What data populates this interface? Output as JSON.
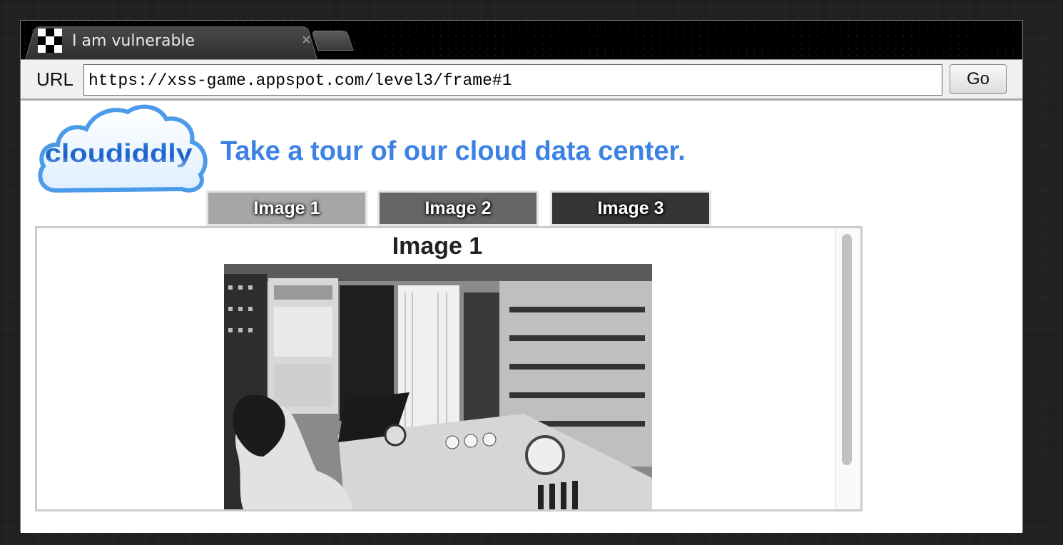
{
  "browser": {
    "tab_title": "I am vulnerable",
    "tab_close": "×",
    "url_label": "URL",
    "url_value": "https://xss-game.appspot.com/level3/frame#1",
    "go_label": "Go"
  },
  "page": {
    "logo_text": "cloudiddly",
    "headline": "Take a tour of our cloud data center.",
    "tabs": [
      {
        "label": "Image 1",
        "color": "#a6a6a6"
      },
      {
        "label": "Image 2",
        "color": "#666666"
      },
      {
        "label": "Image 3",
        "color": "#353535"
      }
    ],
    "content_title": "Image 1",
    "accent_color": "#3b82e4"
  }
}
